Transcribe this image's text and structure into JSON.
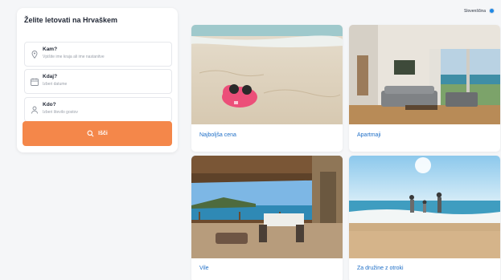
{
  "search": {
    "title": "Želite letovati na Hrvaškem",
    "fields": [
      {
        "label": "Kam?",
        "placeholder": "Vpišite ime kraja ali ime nastanitve"
      },
      {
        "label": "Kdaj?",
        "placeholder": "Izberi datume"
      },
      {
        "label": "Kdo?",
        "placeholder": "Izberi število gostov"
      }
    ],
    "button_label": "Išči",
    "accent_color": "#f4874a"
  },
  "language": {
    "label": "Slovenščina"
  },
  "categories": [
    {
      "label": "Najboljša cena",
      "image": "beach-piggy-bank"
    },
    {
      "label": "Apartmaji",
      "image": "apartment-interior"
    },
    {
      "label": "Vile",
      "image": "villa-terrace-sea"
    },
    {
      "label": "Za družine z otroki",
      "image": "family-beach"
    }
  ],
  "link_color": "#1f6fc7"
}
